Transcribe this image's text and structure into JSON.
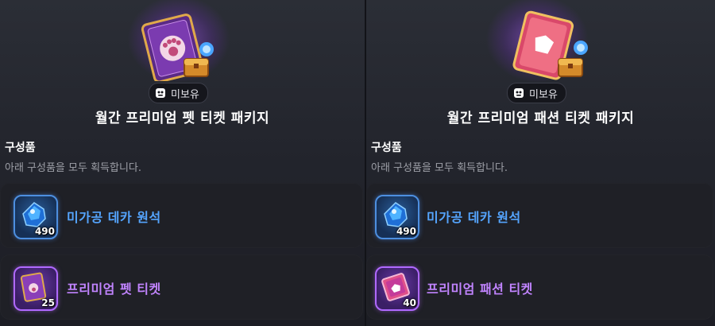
{
  "packages": [
    {
      "badge": "미보유",
      "title": "월간 프리미엄 펫 티켓 패키지",
      "section_title": "구성품",
      "section_desc": "아래 구성품을 모두 획득합니다.",
      "items": [
        {
          "name": "미가공 데카 원석",
          "quantity": "490",
          "icon": "raw-deca-gem-icon",
          "color": "#55a5ff"
        },
        {
          "name": "프리미엄 펫 티켓",
          "quantity": "25",
          "icon": "pet-ticket-icon",
          "color": "#c184ff"
        }
      ]
    },
    {
      "badge": "미보유",
      "title": "월간 프리미엄 패션 티켓 패키지",
      "section_title": "구성품",
      "section_desc": "아래 구성품을 모두 획득합니다.",
      "items": [
        {
          "name": "미가공 데카 원석",
          "quantity": "490",
          "icon": "raw-deca-gem-icon",
          "color": "#55a5ff"
        },
        {
          "name": "프리미엄 패션 티켓",
          "quantity": "40",
          "icon": "fashion-ticket-icon",
          "color": "#c184ff"
        }
      ]
    }
  ]
}
